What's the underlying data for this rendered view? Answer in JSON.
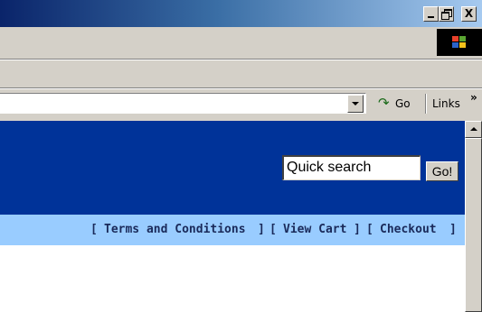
{
  "window": {
    "minimize_label": "_",
    "close_label": "X"
  },
  "address_bar": {
    "url": "",
    "go_label": "Go",
    "links_label": "Links",
    "links_chevron": "»"
  },
  "icons": {
    "go_icon": "go-arrow-icon",
    "windows_logo": "windows-flag-icon"
  },
  "page": {
    "search": {
      "placeholder": "Quick search",
      "button_label": "Go!"
    },
    "nav": {
      "open_bracket": "[",
      "close_bracket": "]",
      "links": [
        "Terms and Conditions",
        "View Cart",
        "Checkout"
      ]
    }
  },
  "colors": {
    "banner": "#003399",
    "nav_strip": "#99ccff",
    "nav_text": "#1a2a5a"
  }
}
